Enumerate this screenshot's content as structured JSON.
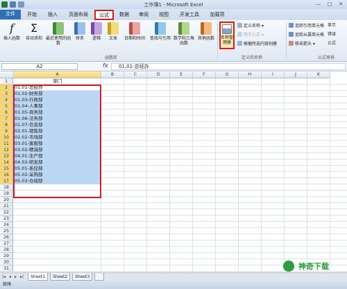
{
  "window": {
    "title": "工作簿1 - Microsoft Excel",
    "controls": [
      "—",
      "□",
      "✕"
    ]
  },
  "tabs": [
    "文件",
    "开始",
    "插入",
    "页面布局",
    "公式",
    "数据",
    "审阅",
    "视图",
    "开发工具",
    "加载项"
  ],
  "ribbon": {
    "buttons": [
      {
        "label": "插入函数",
        "icon": "fx-icon"
      },
      {
        "label": "自动求和",
        "icon": "sigma-icon"
      },
      {
        "label": "最近使用的函数",
        "icon": "book-icon"
      },
      {
        "label": "财务",
        "icon": "book-icon"
      },
      {
        "label": "逻辑",
        "icon": "book-icon"
      },
      {
        "label": "文本",
        "icon": "book-icon"
      },
      {
        "label": "日期和时间",
        "icon": "book-icon"
      },
      {
        "label": "查找与引用",
        "icon": "book-icon"
      },
      {
        "label": "数学和三角函数",
        "icon": "book-icon"
      },
      {
        "label": "其他函数",
        "icon": "book-icon"
      },
      {
        "label": "名称管理器",
        "icon": "name-manager-icon"
      }
    ],
    "group_labels": {
      "library": "函数库",
      "names": "定义的名称",
      "audit": "公式审核"
    },
    "names_cmds": [
      "定义名称 ▾",
      "用于公式 ▾",
      "根据所选内容创建"
    ],
    "audit_cmds": [
      "追踪引用单元格",
      "追踪从属单元格",
      "移去箭头 ▾",
      "显示",
      "错误",
      "公式"
    ]
  },
  "formula_bar": {
    "namebox": "A2",
    "fx": "fx",
    "value": "01.01-总经办"
  },
  "grid": {
    "columns": [
      "A",
      "B",
      "C",
      "D",
      "E",
      "F",
      "G",
      "H",
      "I",
      "J",
      "K"
    ],
    "rows": [
      "1",
      "2",
      "3",
      "4",
      "5",
      "6",
      "7",
      "8",
      "9",
      "10",
      "11",
      "12",
      "13",
      "14",
      "15",
      "16",
      "17",
      "18",
      "19",
      "20",
      "21",
      "22",
      "23",
      "24",
      "25",
      "26",
      "27",
      "28",
      "29",
      "30",
      "31"
    ],
    "header_cell": "部门",
    "cells": [
      "01.01-总经办",
      "01.02-财务部",
      "01.03-行政部",
      "01.04-人事部",
      "01.05-商务部",
      "01.06-法务部",
      "01.07-信息部",
      "02.01-销售部",
      "02.02-市场部",
      "03.01-客服部",
      "03.02-精诚部",
      "04.01-生产部",
      "04.02-研发部",
      "05.01-系控部",
      "05.02-采购部",
      "05.03-仓储部"
    ]
  },
  "sheets": [
    "Sheet1",
    "Sheet2",
    "Sheet3"
  ],
  "status": "就绪",
  "watermark": "神奇下载",
  "colors": {
    "selection": "#bcd7f3",
    "highlight_border": "#c8202a",
    "file_tab": "#2f6fb7"
  }
}
